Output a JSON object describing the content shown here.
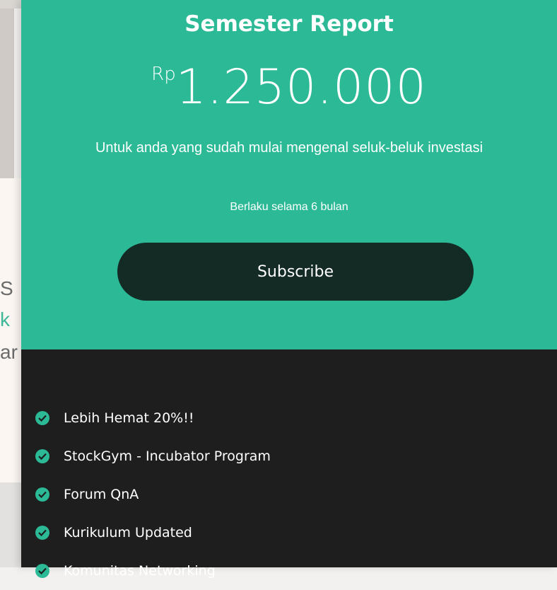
{
  "background": {
    "fragments": [
      "S",
      "k",
      "ar"
    ]
  },
  "plan": {
    "title": "Semester Report",
    "currency": "Rp",
    "price": "1.250.000",
    "description": "Untuk anda yang sudah mulai mengenal seluk-beluk investasi",
    "duration": "Berlaku selama 6 bulan",
    "button_label": "Subscribe",
    "features": [
      "Lebih Hemat 20%!!",
      "StockGym - Incubator Program",
      "Forum QnA",
      "Kurikulum Updated",
      "Komunitas Networking"
    ]
  },
  "colors": {
    "accent": "#2bb996",
    "button": "#142a25",
    "dark_panel": "#1e1e1e"
  }
}
